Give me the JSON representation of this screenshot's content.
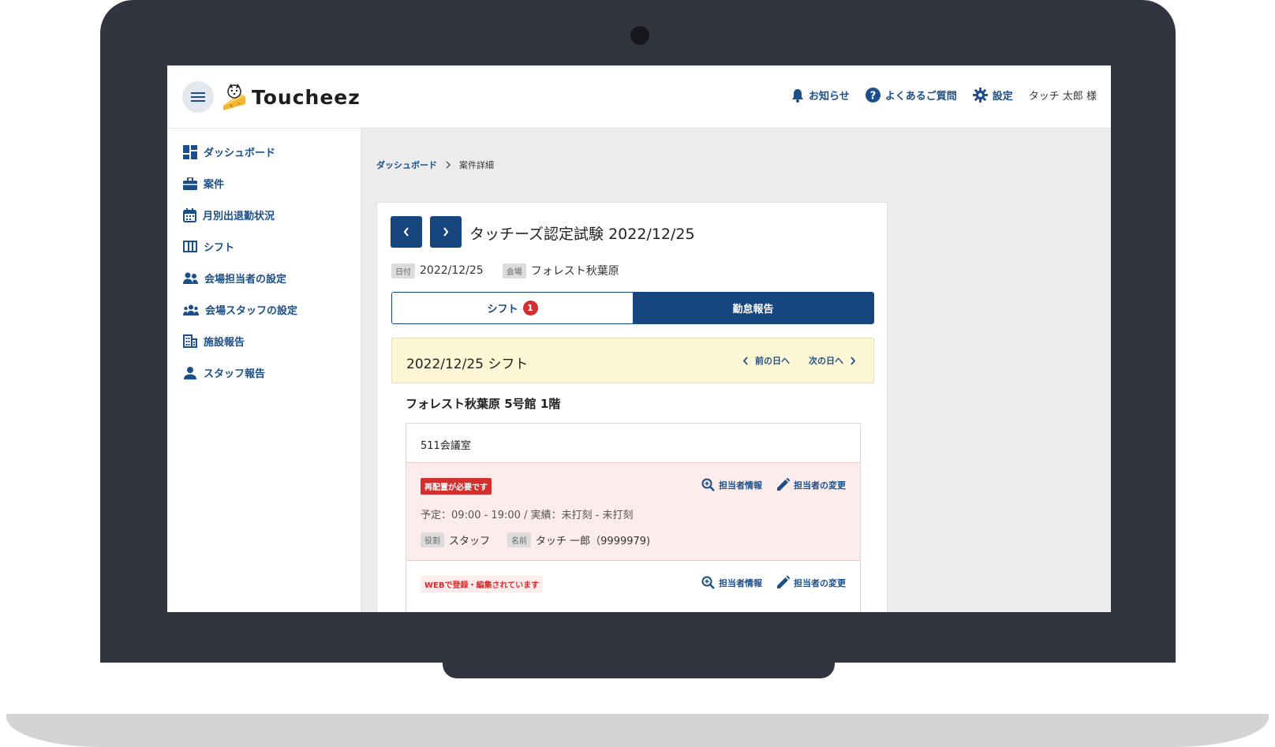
{
  "app": {
    "logo_text": "Toucheez"
  },
  "header": {
    "notifications_label": "お知らせ",
    "faq_label": "よくあるご質問",
    "settings_label": "設定",
    "user_name": "タッチ 太郎 様"
  },
  "sidebar": {
    "items": [
      {
        "label": "ダッシュボード",
        "icon": "dashboard-icon"
      },
      {
        "label": "案件",
        "icon": "briefcase-icon"
      },
      {
        "label": "月別出退勤状況",
        "icon": "calendar-icon"
      },
      {
        "label": "シフト",
        "icon": "columns-icon"
      },
      {
        "label": "会場担当者の設定",
        "icon": "people-icon"
      },
      {
        "label": "会場スタッフの設定",
        "icon": "group-icon"
      },
      {
        "label": "施設報告",
        "icon": "building-icon"
      },
      {
        "label": "スタッフ報告",
        "icon": "person-icon"
      }
    ]
  },
  "breadcrumb": {
    "home": "ダッシュボード",
    "current": "案件詳細"
  },
  "detail": {
    "title": "タッチーズ認定試験 2022/12/25",
    "date_tag": "日付",
    "date_value": "2022/12/25",
    "venue_tag": "会場",
    "venue_value": "フォレスト秋葉原",
    "tab_shift": "シフト",
    "tab_shift_badge": "1",
    "tab_report": "勤怠報告"
  },
  "shift": {
    "title": "2022/12/25 シフト",
    "prev_day": "前の日へ",
    "next_day": "次の日へ",
    "venue_floor": "フォレスト秋葉原 5号館 1階",
    "room": "511会議室",
    "rows": [
      {
        "status": "再配置が必要です",
        "info_label": "担当者情報",
        "change_label": "担当者の変更",
        "schedule": "予定：09:00 - 19:00 / 実績：未打刻 - 未打刻",
        "role_tag": "役割",
        "role_value": "スタッフ",
        "name_tag": "名前",
        "name_value": "タッチ 一郎（9999979)"
      },
      {
        "status": "WEBで登録・編集されています",
        "info_label": "担当者情報",
        "change_label": "担当者の変更"
      }
    ]
  },
  "colors": {
    "primary": "#17467f",
    "alert": "#d32f2f",
    "alert_bg": "#fdecec",
    "shift_head_bg": "#fdf7d6"
  }
}
